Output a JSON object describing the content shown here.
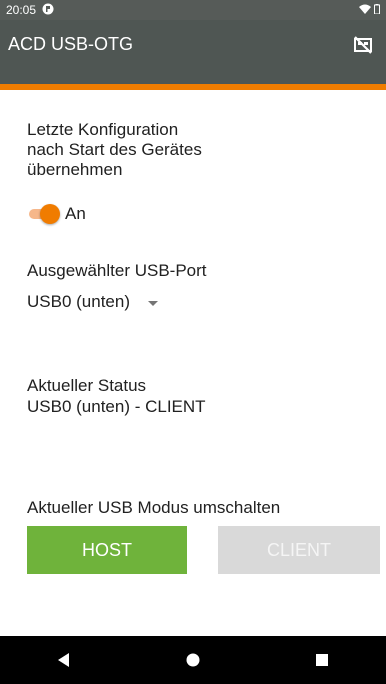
{
  "status_bar": {
    "time": "20:05",
    "notification_icon": "dnd-circle-icon",
    "wifi_icon": "wifi-icon",
    "battery_icon": "battery-icon"
  },
  "app_bar": {
    "title": "ACD USB-OTG",
    "action_icon": "usb-off-icon"
  },
  "settings": {
    "autostart_label": [
      "Letzte Konfiguration",
      "nach Start des Gerätes",
      "übernehmen"
    ],
    "switch_state_label": "An",
    "switch_on": true,
    "port_label": "Ausgewählter USB-Port",
    "port_value": "USB0 (unten)"
  },
  "status": {
    "heading": "Aktueller Status",
    "value": "USB0 (unten) - CLIENT"
  },
  "mode": {
    "heading": "Aktueller USB Modus umschalten",
    "host_label": "HOST",
    "client_label": "CLIENT"
  },
  "colors": {
    "accent": "#f07c00",
    "app_bar": "#4f5653",
    "host_button": "#6fb33b",
    "client_button_disabled": "#d9d9d9"
  }
}
